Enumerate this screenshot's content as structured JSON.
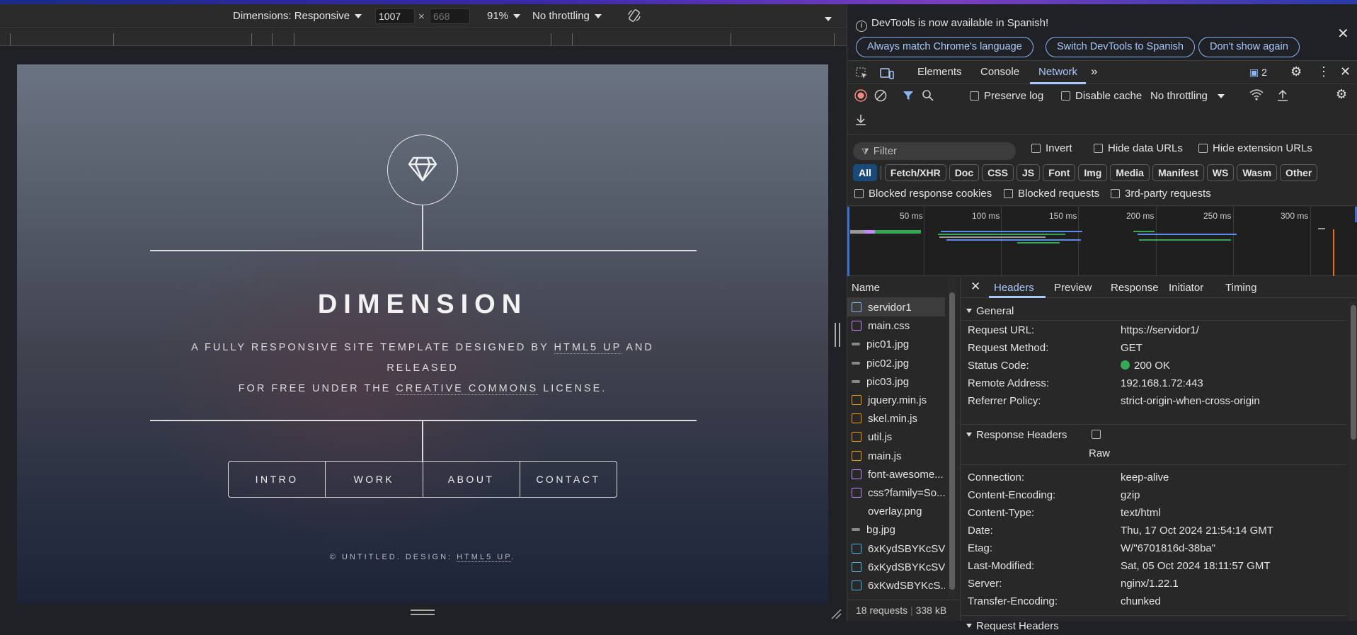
{
  "device_toolbar": {
    "dimensions_label": "Dimensions: Responsive",
    "width_value": "1007",
    "times": "×",
    "height_value": "668",
    "zoom": "91%",
    "throttling": "No throttling"
  },
  "site": {
    "title": "DIMENSION",
    "subtitle_parts": [
      "A FULLY RESPONSIVE SITE TEMPLATE DESIGNED BY ",
      "HTML5 UP",
      " AND RELEASED",
      "FOR FREE UNDER THE ",
      "CREATIVE COMMONS",
      " LICENSE."
    ],
    "nav": [
      "INTRO",
      "WORK",
      "ABOUT",
      "CONTACT"
    ],
    "footer_parts": [
      "© UNTITLED. DESIGN: ",
      "HTML5 UP",
      "."
    ]
  },
  "devtools": {
    "info_message": "DevTools is now available in Spanish!",
    "info_buttons": [
      "Always match Chrome's language",
      "Switch DevTools to Spanish",
      "Don't show again"
    ],
    "tabs": [
      "Elements",
      "Console",
      "Network"
    ],
    "issues_count": "2",
    "toolbar": {
      "preserve_log": "Preserve log",
      "disable_cache": "Disable cache",
      "throttling": "No throttling"
    },
    "filter": {
      "placeholder": "Filter",
      "invert": "Invert",
      "hide_data_urls": "Hide data URLs",
      "hide_extension_urls": "Hide extension URLs",
      "types": [
        "All",
        "Fetch/XHR",
        "Doc",
        "CSS",
        "JS",
        "Font",
        "Img",
        "Media",
        "Manifest",
        "WS",
        "Wasm",
        "Other"
      ],
      "blocked_response_cookies": "Blocked response cookies",
      "blocked_requests": "Blocked requests",
      "third_party": "3rd-party requests"
    },
    "overview_ticks": [
      "50 ms",
      "100 ms",
      "150 ms",
      "200 ms",
      "250 ms",
      "300 ms"
    ],
    "name_header": "Name",
    "requests": [
      {
        "name": "servidor1",
        "type": "doc"
      },
      {
        "name": "main.css",
        "type": "css"
      },
      {
        "name": "pic01.jpg",
        "type": "img"
      },
      {
        "name": "pic02.jpg",
        "type": "img"
      },
      {
        "name": "pic03.jpg",
        "type": "img"
      },
      {
        "name": "jquery.min.js",
        "type": "js"
      },
      {
        "name": "skel.min.js",
        "type": "js"
      },
      {
        "name": "util.js",
        "type": "js"
      },
      {
        "name": "main.js",
        "type": "js"
      },
      {
        "name": "font-awesome...",
        "type": "css"
      },
      {
        "name": "css?family=So...",
        "type": "css"
      },
      {
        "name": "overlay.png",
        "type": "none"
      },
      {
        "name": "bg.jpg",
        "type": "img"
      },
      {
        "name": "6xKydSBYKcSV...",
        "type": "font"
      },
      {
        "name": "6xKydSBYKcSV...",
        "type": "font"
      },
      {
        "name": "6xKwdSBYKcS...",
        "type": "font"
      }
    ],
    "status": {
      "requests": "18 requests",
      "size": "338 kB"
    },
    "detail_tabs": [
      "Headers",
      "Preview",
      "Response",
      "Initiator",
      "Timing"
    ],
    "general_title": "General",
    "general": [
      {
        "k": "Request URL:",
        "v": "https://servidor1/"
      },
      {
        "k": "Request Method:",
        "v": "GET"
      },
      {
        "k": "Status Code:",
        "v": "200 OK"
      },
      {
        "k": "Remote Address:",
        "v": "192.168.1.72:443"
      },
      {
        "k": "Referrer Policy:",
        "v": "strict-origin-when-cross-origin"
      }
    ],
    "response_headers_title": "Response Headers",
    "raw_label": "Raw",
    "response_headers": [
      {
        "k": "Connection:",
        "v": "keep-alive"
      },
      {
        "k": "Content-Encoding:",
        "v": "gzip"
      },
      {
        "k": "Content-Type:",
        "v": "text/html"
      },
      {
        "k": "Date:",
        "v": "Thu, 17 Oct 2024 21:54:14 GMT"
      },
      {
        "k": "Etag:",
        "v": "W/\"6701816d-38ba\""
      },
      {
        "k": "Last-Modified:",
        "v": "Sat, 05 Oct 2024 18:11:57 GMT"
      },
      {
        "k": "Server:",
        "v": "nginx/1.22.1"
      },
      {
        "k": "Transfer-Encoding:",
        "v": "chunked"
      }
    ],
    "request_headers_title": "Request Headers"
  },
  "colors": {
    "accent": "#a8c7fa",
    "status_ok": "#34a853",
    "devtools_bg": "#282828"
  }
}
